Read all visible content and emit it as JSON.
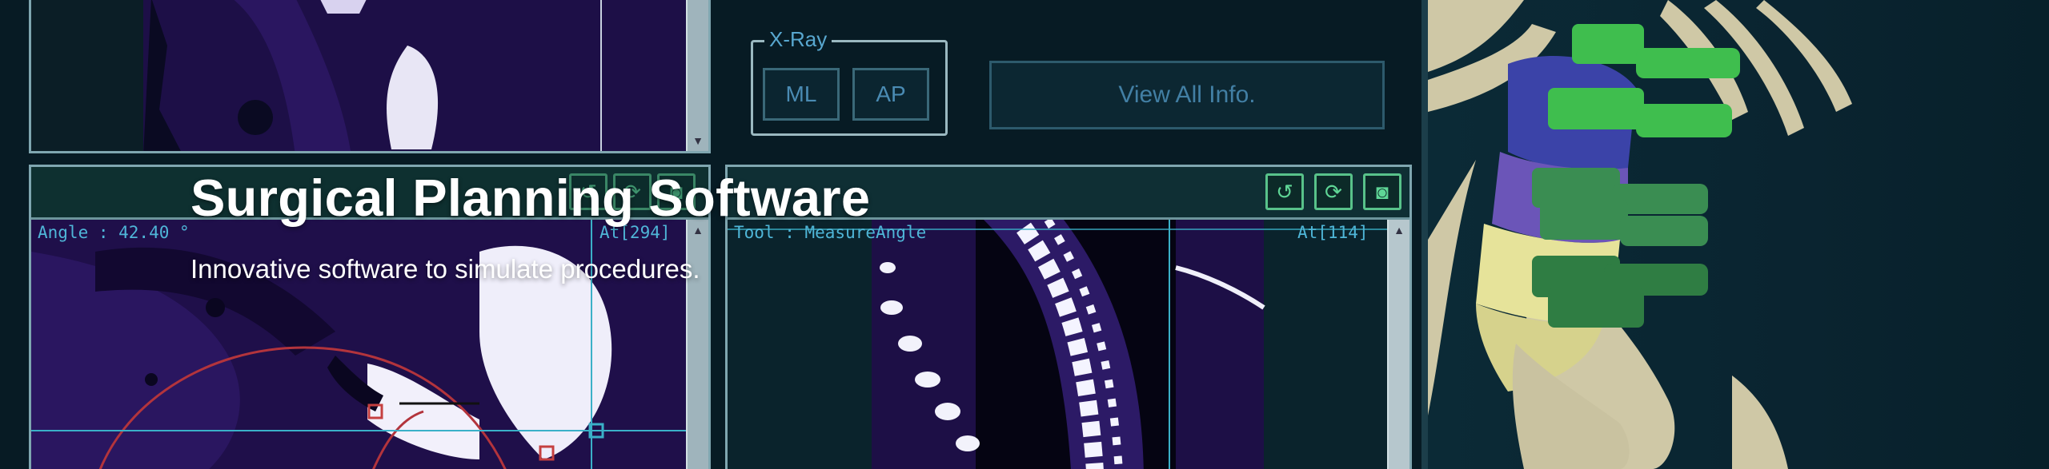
{
  "hero": {
    "title": "Surgical Planning Software",
    "subtitle": "Innovative software to simulate procedures."
  },
  "xray_group": {
    "title": "X-Ray",
    "buttons": [
      "ML",
      "AP"
    ]
  },
  "view_all_button": "View All Info.",
  "left_view": {
    "angle_label": "Angle : 42.40 °",
    "position_label": "At[294]"
  },
  "center_view": {
    "tool_label": "Tool : MeasureAngle",
    "position_label": "At[114]",
    "tools": [
      "undo-icon",
      "refresh-icon",
      "camera-icon"
    ]
  },
  "colors": {
    "background": "#071b24",
    "ct_scan": "#160a3a",
    "accent_green": "#5fd696",
    "label_blue": "#4fb6d8",
    "implant_green": "#3fbe4e"
  }
}
